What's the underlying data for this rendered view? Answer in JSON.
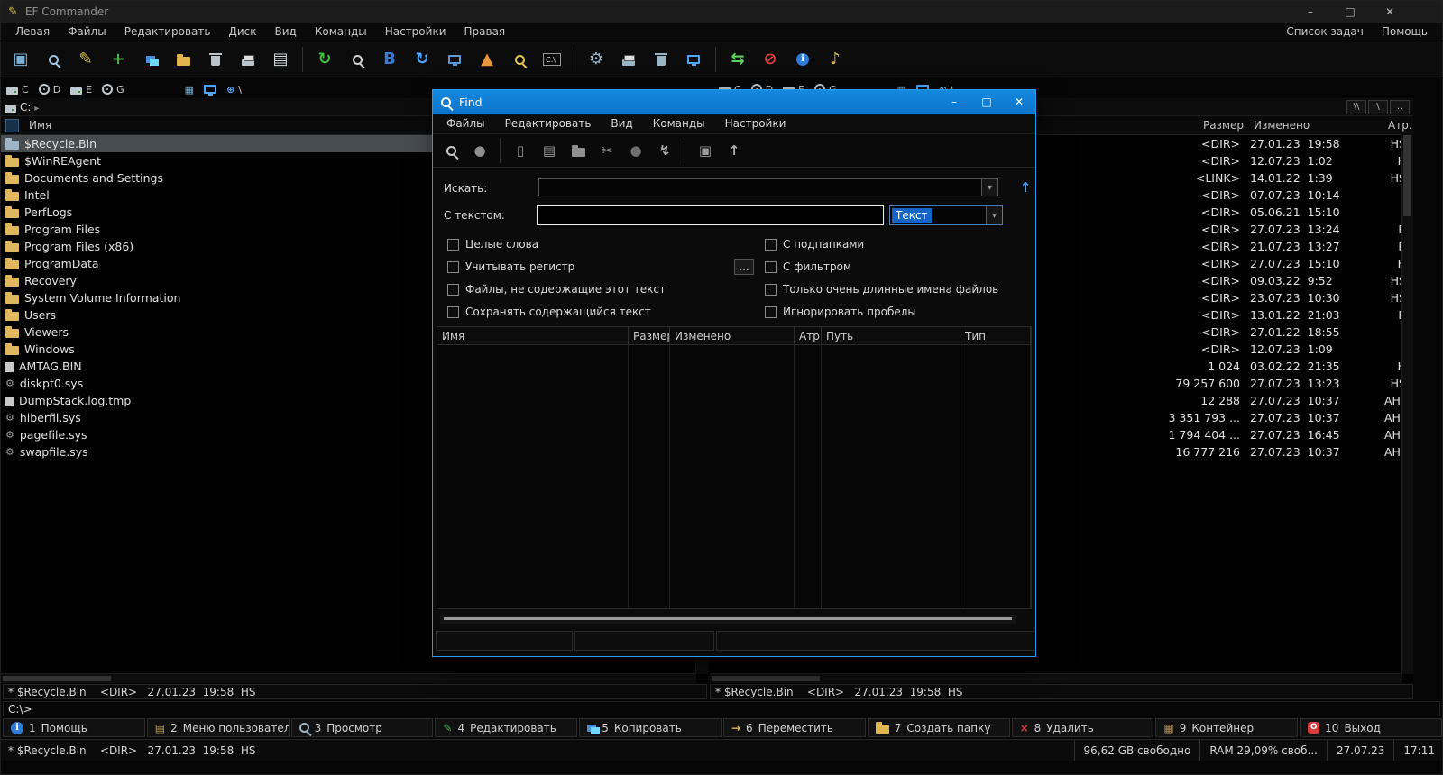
{
  "window": {
    "title": "EF Commander",
    "controls": {
      "minimize": "–",
      "maximize": "□",
      "close": "✕"
    }
  },
  "menubar": {
    "items": [
      "Левая",
      "Файлы",
      "Редактировать",
      "Диск",
      "Вид",
      "Команды",
      "Настройки",
      "Правая"
    ],
    "right_items": [
      "Список задач",
      "Помощь"
    ]
  },
  "toolbar": {
    "items": [
      {
        "name": "panel-view-icon",
        "glyph": "▣",
        "color": "#7bafd4"
      },
      {
        "name": "find-files-icon",
        "shape": "magnifier",
        "color": "#9ec6e8"
      },
      {
        "name": "edit-file-icon",
        "glyph": "✎",
        "color": "#e3c44a"
      },
      {
        "name": "copy-new-icon",
        "glyph": "+",
        "color": "#46b04a"
      },
      {
        "name": "copy-files-icon",
        "shape": "folders",
        "color": "#4a90d9"
      },
      {
        "name": "new-folder-icon",
        "shape": "folder",
        "color": "#e0b54e"
      },
      {
        "name": "delete-icon",
        "shape": "trash",
        "color": "#b9c4cc"
      },
      {
        "name": "print-icon",
        "shape": "printer",
        "color": "#b9c4cc"
      },
      {
        "name": "file-list-icon",
        "glyph": "▤",
        "color": "#cfd8dc"
      },
      {
        "sep": true
      },
      {
        "name": "refresh-icon",
        "glyph": "↻",
        "color": "#3fbf3f"
      },
      {
        "name": "search-icon",
        "shape": "magnifier",
        "color": "#d0d0d0"
      },
      {
        "name": "quick-view-icon",
        "glyph": "B",
        "color": "#3b7bd4"
      },
      {
        "name": "reread-icon",
        "glyph": "↻",
        "color": "#4da6ff"
      },
      {
        "name": "find-computer-icon",
        "shape": "screen",
        "color": "#5b9bd5"
      },
      {
        "name": "signal-cone-icon",
        "glyph": "▲",
        "color": "#e8963d"
      },
      {
        "name": "search-folder-icon",
        "shape": "magnifier",
        "color": "#e3c44a"
      },
      {
        "name": "terminal-icon",
        "shape": "terminal",
        "color": "#d8d8d8"
      },
      {
        "sep": true
      },
      {
        "name": "system-tools-icon",
        "glyph": "⚙",
        "color": "#9ab4c4"
      },
      {
        "name": "printer-setup-icon",
        "shape": "printer",
        "color": "#9ab4c4"
      },
      {
        "name": "recycle-icon",
        "shape": "trash",
        "color": "#9ab4c4"
      },
      {
        "name": "display-icon",
        "shape": "screen",
        "color": "#4da6ff"
      },
      {
        "sep": true
      },
      {
        "name": "net-connect-icon",
        "glyph": "⇆",
        "color": "#5fcf5f"
      },
      {
        "name": "net-disconnect-icon",
        "glyph": "⊘",
        "color": "#e03c3c"
      },
      {
        "name": "info-icon",
        "shape": "info",
        "color": "#2e7cd6"
      },
      {
        "name": "audio-icon",
        "glyph": "♪",
        "color": "#d8b84a"
      }
    ]
  },
  "drivebar": {
    "drives": [
      {
        "label": "C",
        "icon": "hdd"
      },
      {
        "label": "D",
        "icon": "cd"
      },
      {
        "label": "E",
        "icon": "hdd"
      },
      {
        "label": "G",
        "icon": "cd"
      }
    ],
    "extras": [
      {
        "name": "floppy-icon",
        "glyph": "▦",
        "color": "#7ab0d4"
      },
      {
        "name": "desktop-icon",
        "shape": "screen",
        "color": "#4da6ff"
      },
      {
        "name": "network-icon",
        "glyph": "⊕",
        "color": "#4da6ff",
        "label": "\\"
      }
    ]
  },
  "panels": {
    "columns": [
      "Имя",
      "Размер",
      "Изменено",
      "Атр..."
    ],
    "path_buttons": [
      "\\\\",
      "\\",
      ".."
    ],
    "left": {
      "path": "C:",
      "status": "* $Recycle.Bin    <DIR>   27.01.23  19:58  HS"
    },
    "right": {
      "path": "C:",
      "status": "* $Recycle.Bin    <DIR>   27.01.23  19:58  HS"
    },
    "files": [
      {
        "name": "$Recycle.Bin",
        "icon": "recycle",
        "size": "<DIR>",
        "modified": "27.01.23  19:58",
        "attr": "HS",
        "selected": true
      },
      {
        "name": "$WinREAgent",
        "icon": "folder",
        "size": "<DIR>",
        "modified": "12.07.23  1:02",
        "attr": "H"
      },
      {
        "name": "Documents and Settings",
        "icon": "folder-link",
        "size": "<LINK>",
        "modified": "14.01.22  1:39",
        "attr": "HS"
      },
      {
        "name": "Intel",
        "icon": "folder",
        "size": "<DIR>",
        "modified": "07.07.23  10:14",
        "attr": ""
      },
      {
        "name": "PerfLogs",
        "icon": "folder",
        "size": "<DIR>",
        "modified": "05.06.21  15:10",
        "attr": ""
      },
      {
        "name": "Program Files",
        "icon": "folder",
        "size": "<DIR>",
        "modified": "27.07.23  13:24",
        "attr": "R"
      },
      {
        "name": "Program Files (x86)",
        "icon": "folder",
        "size": "<DIR>",
        "modified": "21.07.23  13:27",
        "attr": "R"
      },
      {
        "name": "ProgramData",
        "icon": "folder",
        "size": "<DIR>",
        "modified": "27.07.23  15:10",
        "attr": "H"
      },
      {
        "name": "Recovery",
        "icon": "folder",
        "size": "<DIR>",
        "modified": "09.03.22  9:52",
        "attr": "HS"
      },
      {
        "name": "System Volume Information",
        "icon": "folder",
        "size": "<DIR>",
        "modified": "23.07.23  10:30",
        "attr": "HS"
      },
      {
        "name": "Users",
        "icon": "folder",
        "size": "<DIR>",
        "modified": "13.01.22  21:03",
        "attr": "R"
      },
      {
        "name": "Viewers",
        "icon": "folder",
        "size": "<DIR>",
        "modified": "27.01.22  18:55",
        "attr": ""
      },
      {
        "name": "Windows",
        "icon": "folder",
        "size": "<DIR>",
        "modified": "12.07.23  1:09",
        "attr": ""
      },
      {
        "name": "AMTAG.BIN",
        "icon": "file",
        "size": "1 024",
        "modified": "03.02.22  21:35",
        "attr": "H"
      },
      {
        "name": "diskpt0.sys",
        "icon": "gear",
        "size": "79 257 600",
        "modified": "27.07.23  13:23",
        "attr": "HS"
      },
      {
        "name": "DumpStack.log.tmp",
        "icon": "file",
        "size": "12 288",
        "modified": "27.07.23  10:37",
        "attr": "AHS"
      },
      {
        "name": "hiberfil.sys",
        "icon": "gear",
        "size": "3 351 793 ...",
        "modified": "27.07.23  10:37",
        "attr": "AHS"
      },
      {
        "name": "pagefile.sys",
        "icon": "gear",
        "size": "1 794 404 ...",
        "modified": "27.07.23  16:45",
        "attr": "AHS"
      },
      {
        "name": "swapfile.sys",
        "icon": "gear",
        "size": "16 777 216",
        "modified": "27.07.23  10:37",
        "attr": "AHS"
      }
    ]
  },
  "find_dialog": {
    "title": "Find",
    "controls": {
      "minimize": "–",
      "maximize": "□",
      "close": "✕"
    },
    "menu": [
      "Файлы",
      "Редактировать",
      "Вид",
      "Команды",
      "Настройки"
    ],
    "toolbar": [
      {
        "name": "start-search-icon",
        "shape": "magnifier",
        "color": "#c8c8c8"
      },
      {
        "name": "stop-icon",
        "glyph": "●",
        "color": "#8f8f8f"
      },
      {
        "sep": true
      },
      {
        "name": "new-search-icon",
        "glyph": "▯",
        "color": "#9a9a9a"
      },
      {
        "name": "result-list-icon",
        "glyph": "▤",
        "color": "#9a9a9a"
      },
      {
        "name": "open-folder-icon",
        "shape": "folder",
        "color": "#8f8f8f"
      },
      {
        "name": "cut-icon",
        "glyph": "✂",
        "color": "#9a9a9a"
      },
      {
        "name": "pause-icon",
        "glyph": "●",
        "color": "#6f6f6f"
      },
      {
        "name": "run-icon",
        "glyph": "↯",
        "color": "#b0b0b0"
      },
      {
        "sep": true
      },
      {
        "name": "save-result-icon",
        "glyph": "▣",
        "color": "#9a9a9a"
      },
      {
        "name": "go-up-icon",
        "glyph": "↑",
        "color": "#b0b0b0"
      }
    ],
    "search_label": "Искать:",
    "text_label": "С текстом:",
    "text_value": "Текст",
    "more_button": "...",
    "checkboxes_left": [
      {
        "key": "whole-words",
        "label": "Целые слова"
      },
      {
        "key": "match-case",
        "label": "Учитывать регистр"
      },
      {
        "key": "files-not-containing",
        "label": "Файлы, не содержащие этот текст"
      },
      {
        "key": "keep-contained-text",
        "label": "Сохранять содержащийся текст"
      }
    ],
    "checkboxes_right": [
      {
        "key": "with-subfolders",
        "label": "С подпапками"
      },
      {
        "key": "with-filter",
        "label": "С фильтром"
      },
      {
        "key": "very-long-names",
        "label": "Только очень длинные имена файлов"
      },
      {
        "key": "ignore-spaces",
        "label": "Игнорировать пробелы"
      }
    ],
    "result_columns": [
      {
        "key": "name",
        "label": "Имя"
      },
      {
        "key": "size",
        "label": "Размер"
      },
      {
        "key": "modified",
        "label": "Изменено"
      },
      {
        "key": "attr",
        "label": "Атр..."
      },
      {
        "key": "path",
        "label": "Путь"
      },
      {
        "key": "type",
        "label": "Тип"
      }
    ]
  },
  "command_line": "C:\\>",
  "function_keys": [
    {
      "num": "1",
      "label": "Помощь",
      "key": "help",
      "icon": {
        "name": "help-icon",
        "shape": "info",
        "color": "#2e7cd6"
      }
    },
    {
      "num": "2",
      "label": "Меню пользователя",
      "key": "user-menu",
      "icon": {
        "name": "user-menu-icon",
        "glyph": "▤",
        "color": "#c49a4a"
      }
    },
    {
      "num": "3",
      "label": "Просмотр",
      "key": "view",
      "icon": {
        "name": "view-icon",
        "shape": "magnifier",
        "color": "#9ab4c4"
      }
    },
    {
      "num": "4",
      "label": "Редактировать",
      "key": "edit",
      "icon": {
        "name": "edit-icon",
        "glyph": "✎",
        "color": "#46b04a"
      }
    },
    {
      "num": "5",
      "label": "Копировать",
      "key": "copy",
      "icon": {
        "name": "copy-icon",
        "shape": "folders",
        "color": "#4a90d9"
      }
    },
    {
      "num": "6",
      "label": "Переместить",
      "key": "move",
      "icon": {
        "name": "move-icon",
        "glyph": "→",
        "color": "#e0b54e"
      }
    },
    {
      "num": "7",
      "label": "Создать папку",
      "key": "mkdir",
      "icon": {
        "name": "new-folder-icon",
        "shape": "folder",
        "color": "#e0b54e"
      }
    },
    {
      "num": "8",
      "label": "Удалить",
      "key": "delete",
      "icon": {
        "name": "delete-icon",
        "glyph": "×",
        "color": "#e03c3c"
      }
    },
    {
      "num": "9",
      "label": "Контейнер",
      "key": "container",
      "icon": {
        "name": "container-icon",
        "glyph": "▦",
        "color": "#b08d57"
      }
    },
    {
      "num": "10",
      "label": "Выход",
      "key": "exit",
      "icon": {
        "name": "exit-icon",
        "shape": "exit",
        "color": "#d83c3c"
      }
    }
  ],
  "statusbar": {
    "selection": "* $Recycle.Bin    <DIR>   27.01.23  19:58  HS",
    "free_space": "96,62 GB свободно",
    "ram": "RAM 29,09% своб...",
    "date": "27.07.23",
    "time": "17:11"
  }
}
